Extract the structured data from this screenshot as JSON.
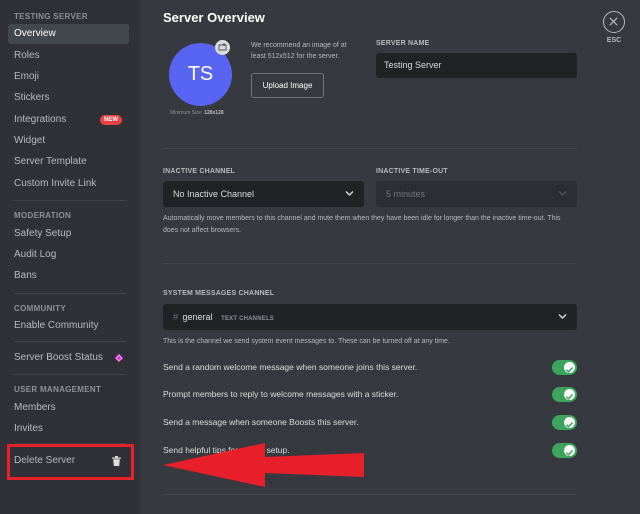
{
  "sidebar": {
    "section_server": "TESTING SERVER",
    "items_server": [
      {
        "label": "Overview"
      },
      {
        "label": "Roles"
      },
      {
        "label": "Emoji"
      },
      {
        "label": "Stickers"
      },
      {
        "label": "Integrations",
        "badge": "NEW"
      },
      {
        "label": "Widget"
      },
      {
        "label": "Server Template"
      },
      {
        "label": "Custom Invite Link"
      }
    ],
    "section_moderation": "MODERATION",
    "items_moderation": [
      {
        "label": "Safety Setup"
      },
      {
        "label": "Audit Log"
      },
      {
        "label": "Bans"
      }
    ],
    "section_community": "COMMUNITY",
    "items_community": [
      {
        "label": "Enable Community"
      }
    ],
    "boost_status": "Server Boost Status",
    "section_user_mgmt": "USER MANAGEMENT",
    "items_user_mgmt": [
      {
        "label": "Members"
      },
      {
        "label": "Invites"
      }
    ],
    "delete_server": "Delete Server"
  },
  "main": {
    "title": "Server Overview",
    "esc_label": "ESC",
    "avatar_initials": "TS",
    "min_size_prefix": "Minimum Size:",
    "min_size_value": "128x128",
    "recommend_text": "We recommend an image of at least 512x512 for the server.",
    "upload_button": "Upload Image",
    "server_name_label": "SERVER NAME",
    "server_name_value": "Testing Server",
    "inactive_channel_label": "INACTIVE CHANNEL",
    "inactive_channel_value": "No Inactive Channel",
    "inactive_timeout_label": "INACTIVE TIME-OUT",
    "inactive_timeout_value": "5 minutes",
    "inactive_help": "Automatically move members to this channel and mute them when they have been idle for longer than the inactive time-out. This does not affect browsers.",
    "system_channel_label": "SYSTEM MESSAGES CHANNEL",
    "system_channel_hash": "#",
    "system_channel_name": "general",
    "system_channel_tag": "TEXT CHANNELS",
    "system_help": "This is the channel we send system event messages to. These can be turned off at any time.",
    "toggles": [
      {
        "label": "Send a random welcome message when someone joins this server.",
        "on": true
      },
      {
        "label": "Prompt members to reply to welcome messages with a sticker.",
        "on": true
      },
      {
        "label": "Send a message when someone Boosts this server.",
        "on": true
      },
      {
        "label": "Send helpful tips for server setup.",
        "on": true
      }
    ]
  },
  "colors": {
    "accent": "#5865f2",
    "toggle_on": "#3ba55c",
    "badge_new": "#ed4245",
    "annotation": "#e8202a"
  }
}
